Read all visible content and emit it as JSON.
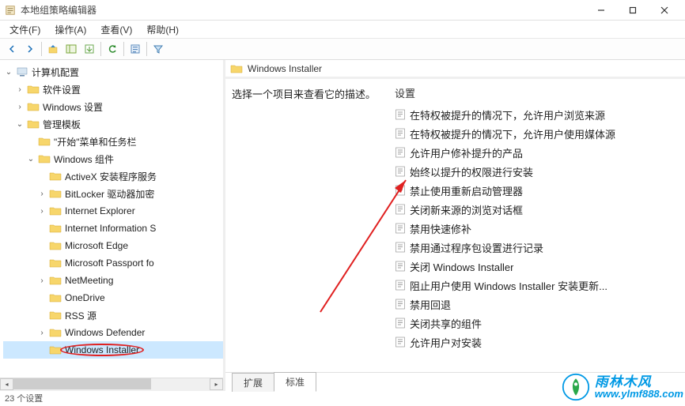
{
  "window": {
    "title": "本地组策略编辑器"
  },
  "menubar": {
    "file": "文件(F)",
    "action": "操作(A)",
    "view": "查看(V)",
    "help": "帮助(H)"
  },
  "tree": {
    "root": "计算机配置",
    "software_settings": "软件设置",
    "windows_settings": "Windows 设置",
    "admin_templates": "管理模板",
    "start_menu": "\"开始\"菜单和任务栏",
    "windows_components": "Windows 组件",
    "items": {
      "activex": "ActiveX 安装程序服务",
      "bitlocker": "BitLocker 驱动器加密",
      "ie": "Internet Explorer",
      "iis": "Internet Information S",
      "edge": "Microsoft Edge",
      "passport": "Microsoft Passport fo",
      "netmeeting": "NetMeeting",
      "onedrive": "OneDrive",
      "rss": "RSS 源",
      "defender": "Windows Defender",
      "installer": "Windows Installer"
    }
  },
  "content": {
    "header": "Windows Installer",
    "description": "选择一个项目来查看它的描述。",
    "column_header": "设置",
    "settings": [
      "在特权被提升的情况下，允许用户浏览来源",
      "在特权被提升的情况下，允许用户使用媒体源",
      "允许用户修补提升的产品",
      "始终以提升的权限进行安装",
      "禁止使用重新启动管理器",
      "关闭新来源的浏览对话框",
      "禁用快速修补",
      "禁用通过程序包设置进行记录",
      "关闭 Windows Installer",
      "阻止用户使用 Windows Installer 安装更新...",
      "禁用回退",
      "关闭共享的组件",
      "允许用户对安装"
    ]
  },
  "tabs": {
    "extended": "扩展",
    "standard": "标准"
  },
  "status": "23 个设置",
  "watermark": {
    "cn": "雨林木风",
    "url": "www.ylmf888.com"
  }
}
